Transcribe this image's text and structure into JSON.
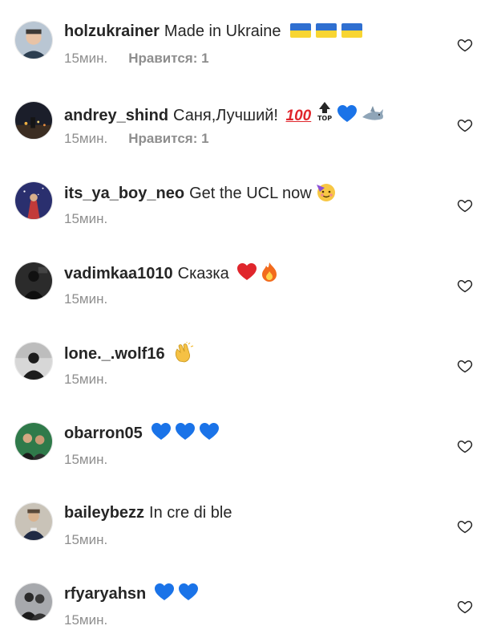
{
  "comments": [
    {
      "username": "holzukrainer",
      "text": "Made in Ukraine",
      "emoji": [
        "ukraine-flag",
        "ukraine-flag",
        "ukraine-flag"
      ],
      "time": "15мин.",
      "likes": "Нравится: 1"
    },
    {
      "username": "andrey_shind",
      "text": "Саня,Лучший!",
      "emoji": [
        "hundred-points",
        "top-arrow",
        "blue-heart",
        "shark"
      ],
      "time": "15мин.",
      "likes": "Нравится: 1"
    },
    {
      "username": "its_ya_boy_neo",
      "text": "Get the UCL now",
      "emoji": [
        "partying-face"
      ],
      "time": "15мин.",
      "likes": ""
    },
    {
      "username": "vadimkaa1010",
      "text": "Сказка",
      "emoji": [
        "red-heart",
        "fire"
      ],
      "time": "15мин.",
      "likes": ""
    },
    {
      "username": "lone._.wolf16",
      "text": "",
      "emoji": [
        "clapping-hands"
      ],
      "time": "15мин.",
      "likes": ""
    },
    {
      "username": "obarron05",
      "text": "",
      "emoji": [
        "blue-heart",
        "blue-heart",
        "blue-heart"
      ],
      "time": "15мин.",
      "likes": ""
    },
    {
      "username": "baileybezz",
      "text": "In cre di ble",
      "emoji": [],
      "time": "15мин.",
      "likes": ""
    },
    {
      "username": "rfyaryahsn",
      "text": "",
      "emoji": [
        "blue-heart",
        "blue-heart"
      ],
      "time": "15мин.",
      "likes": ""
    }
  ],
  "icons": {
    "like": "heart-outline-icon"
  },
  "colors": {
    "text": "#262626",
    "meta": "#8e8e8e",
    "blue_heart": "#1a73e8",
    "red_heart": "#e0262c"
  }
}
